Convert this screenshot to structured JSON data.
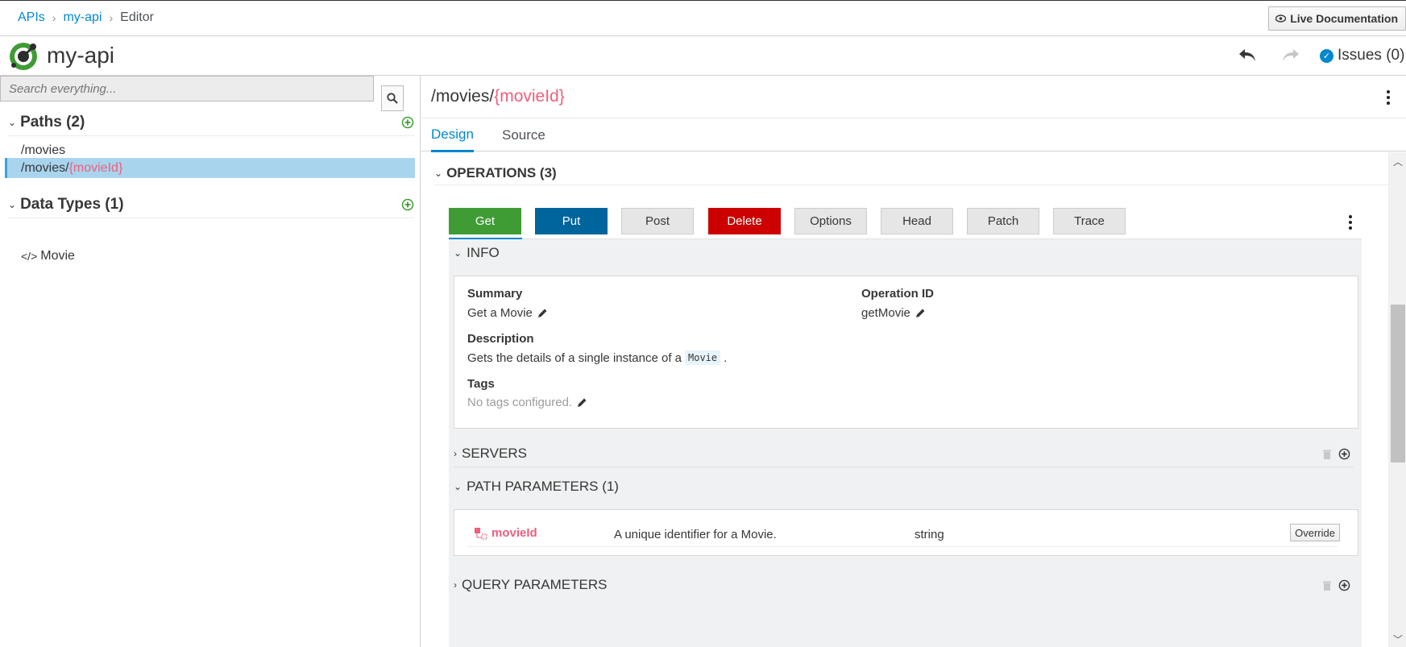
{
  "breadcrumb": {
    "root": "APIs",
    "api": "my-api",
    "current": "Editor"
  },
  "header": {
    "live_doc_label": "Live Documentation",
    "api_name": "my-api",
    "issues_label": "Issues (0)"
  },
  "search": {
    "placeholder": "Search everything..."
  },
  "sidebar": {
    "paths_title": "Paths (2)",
    "paths": [
      {
        "prefix": "/movies",
        "param": ""
      },
      {
        "prefix": "/movies/",
        "param": "{movieId}"
      }
    ],
    "datatypes_title": "Data Types (1)",
    "datatypes": [
      {
        "label": "Movie",
        "icon": "code-icon"
      }
    ]
  },
  "main": {
    "path_prefix": "/movies/",
    "path_param": "{movieId}",
    "tabs": [
      {
        "label": "Design"
      },
      {
        "label": "Source"
      }
    ],
    "operations_title": "OPERATIONS (3)",
    "operations": [
      {
        "label": "Get",
        "color": "#3f9c35"
      },
      {
        "label": "Put",
        "color": "#00659c"
      },
      {
        "label": "Post"
      },
      {
        "label": "Delete",
        "color": "#cc0000"
      },
      {
        "label": "Options"
      },
      {
        "label": "Head"
      },
      {
        "label": "Patch"
      },
      {
        "label": "Trace"
      }
    ],
    "info": {
      "title": "INFO",
      "summary_label": "Summary",
      "summary_value": "Get a Movie",
      "opid_label": "Operation ID",
      "opid_value": "getMovie",
      "description_label": "Description",
      "description_before": "Gets the details of a single instance of a",
      "description_code": "Movie",
      "description_after": ".",
      "tags_label": "Tags",
      "tags_value": "No tags configured."
    },
    "servers_title": "SERVERS",
    "path_params_title": "PATH PARAMETERS (1)",
    "path_params": [
      {
        "name": "movieId",
        "description": "A unique identifier for a Movie.",
        "type": "string",
        "action": "Override"
      }
    ],
    "query_params_title": "QUERY PARAMETERS"
  }
}
